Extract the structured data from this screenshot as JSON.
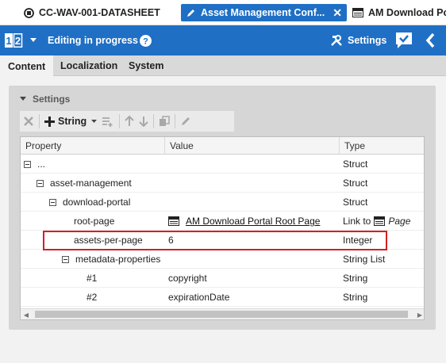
{
  "tabs": [
    {
      "label": "CC-WAV-001-DATASHEET",
      "icon": "document-icon",
      "active": false
    },
    {
      "label": "Asset Management Conf...",
      "icon": "pencil-icon",
      "active": true
    },
    {
      "label": "AM Download Po",
      "icon": "page-icon",
      "active": false
    }
  ],
  "header": {
    "status": "Editing in progress",
    "settings_label": "Settings",
    "accent": "#1f6fc5"
  },
  "subtabs": [
    "Content",
    "Localization",
    "System"
  ],
  "panel": {
    "title": "Settings",
    "toolbar_string_label": "String"
  },
  "grid": {
    "columns": [
      "Property",
      "Value",
      "Type"
    ],
    "rows": [
      {
        "property": "...",
        "value": "",
        "type": "Struct",
        "toggle": true
      },
      {
        "property": "asset-management",
        "value": "",
        "type": "Struct",
        "toggle": true
      },
      {
        "property": "download-portal",
        "value": "",
        "type": "Struct",
        "toggle": true
      },
      {
        "property": "root-page",
        "value": "AM Download Portal Root Page",
        "type_prefix": "Link to",
        "type_suffix": "Page",
        "toggle": false
      },
      {
        "property": "assets-per-page",
        "value": "6",
        "type": "Integer",
        "toggle": false
      },
      {
        "property": "metadata-properties",
        "value": "",
        "type": "String List",
        "toggle": true
      },
      {
        "property": "#1",
        "value": "copyright",
        "type": "String",
        "toggle": false
      },
      {
        "property": "#2",
        "value": "expirationDate",
        "type": "String",
        "toggle": false
      }
    ]
  },
  "highlight_color": "#d32020"
}
